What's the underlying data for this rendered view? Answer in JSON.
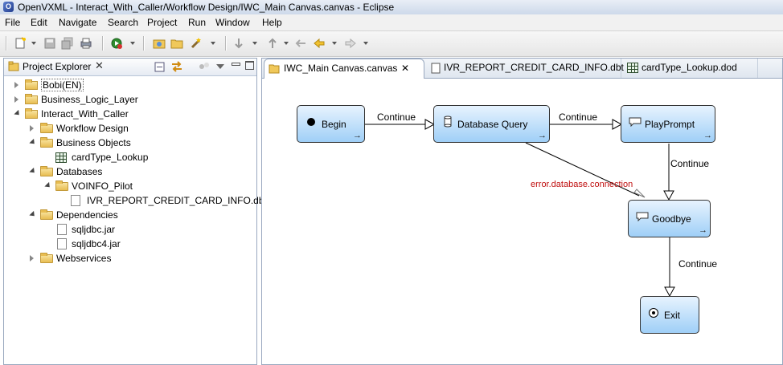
{
  "window": {
    "title": "OpenVXML - Interact_With_Caller/Workflow Design/IWC_Main Canvas.canvas - Eclipse"
  },
  "menu": [
    "File",
    "Edit",
    "Navigate",
    "Search",
    "Project",
    "Run",
    "Window",
    "Help"
  ],
  "explorer": {
    "title": "Project Explorer",
    "tree": [
      {
        "label": "Bobi(EN)"
      },
      {
        "label": "Business_Logic_Layer"
      },
      {
        "label": "Interact_With_Caller"
      },
      {
        "label": "Workflow Design"
      },
      {
        "label": "Business Objects"
      },
      {
        "label": "cardType_Lookup"
      },
      {
        "label": "Databases"
      },
      {
        "label": "VOINFO_Pilot"
      },
      {
        "label": "IVR_REPORT_CREDIT_CARD_INFO.dbt"
      },
      {
        "label": "Dependencies"
      },
      {
        "label": "sqljdbc.jar"
      },
      {
        "label": "sqljdbc4.jar"
      },
      {
        "label": "Webservices"
      }
    ]
  },
  "editor": {
    "tabs": [
      {
        "label": "IWC_Main Canvas.canvas"
      },
      {
        "label": "IVR_REPORT_CREDIT_CARD_INFO.dbt"
      },
      {
        "label": "cardType_Lookup.dod"
      }
    ],
    "nodes": {
      "begin": "Begin",
      "db_query": "Database Query",
      "play_prompt": "PlayPrompt",
      "goodbye": "Goodbye",
      "exit": "Exit"
    },
    "edges": {
      "begin_to_db": "Continue",
      "db_to_prompt": "Continue",
      "prompt_to_goodbye": "Continue",
      "goodbye_to_exit": "Continue",
      "db_error": "error.database.connection"
    }
  },
  "colors": {
    "node_top": "#e7f3fe",
    "node_bottom": "#9fcff7",
    "error_text": "#c01010"
  }
}
